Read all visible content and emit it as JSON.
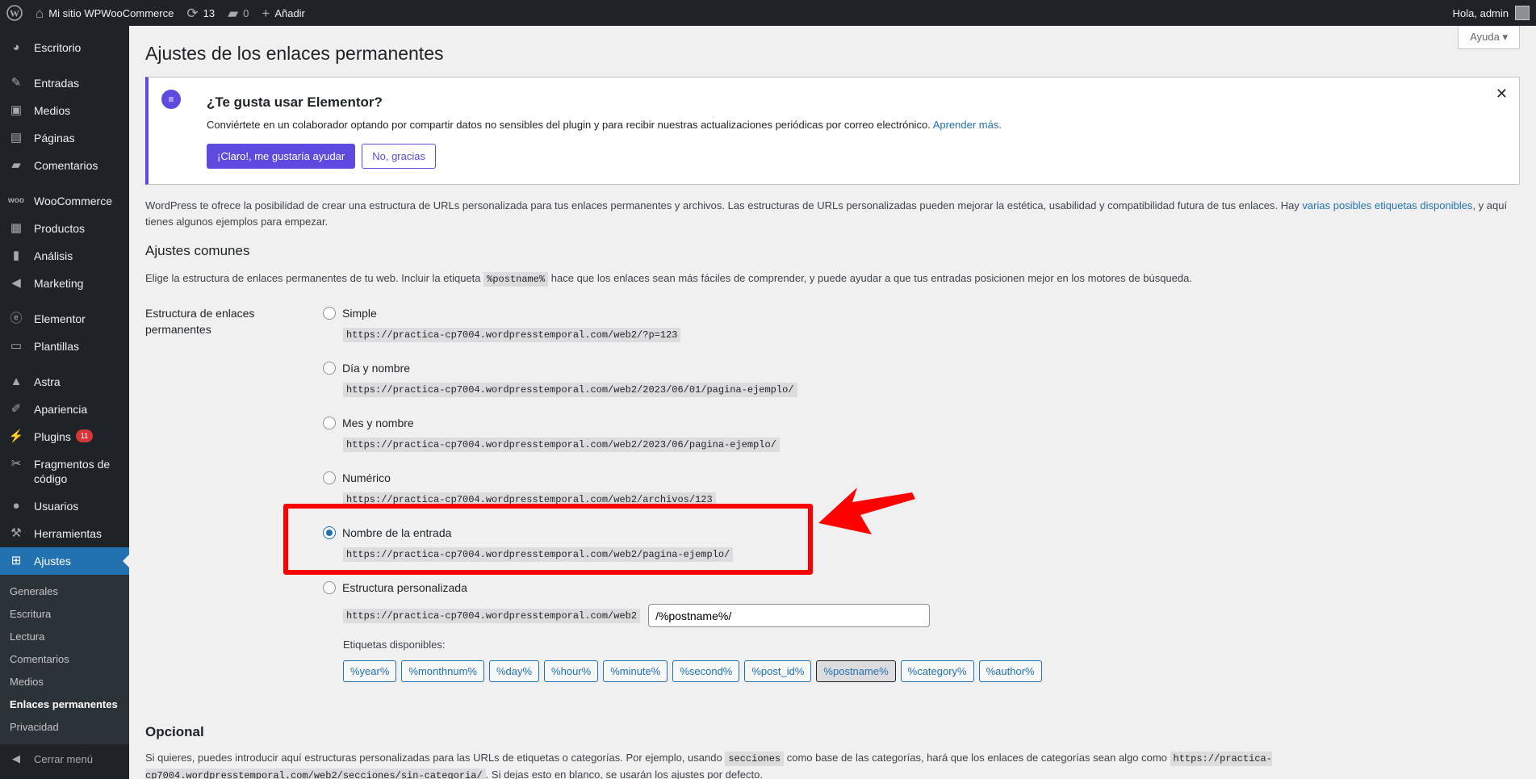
{
  "adminbar": {
    "site_name": "Mi sitio WPWooCommerce",
    "updates_count": "13",
    "comments_count": "0",
    "new_label": "Añadir",
    "greeting": "Hola, admin"
  },
  "sidebar": {
    "items": [
      {
        "label": "Escritorio",
        "icon": "dashboard-icon"
      },
      {
        "label": "Entradas",
        "icon": "pin-icon"
      },
      {
        "label": "Medios",
        "icon": "media-icon"
      },
      {
        "label": "Páginas",
        "icon": "pages-icon"
      },
      {
        "label": "Comentarios",
        "icon": "comments-icon"
      },
      {
        "label": "WooCommerce",
        "icon": "woo-icon"
      },
      {
        "label": "Productos",
        "icon": "archive-icon"
      },
      {
        "label": "Análisis",
        "icon": "chart-icon"
      },
      {
        "label": "Marketing",
        "icon": "megaphone-icon"
      },
      {
        "label": "Elementor",
        "icon": "elementor-icon"
      },
      {
        "label": "Plantillas",
        "icon": "folder-icon"
      },
      {
        "label": "Astra",
        "icon": "astra-icon"
      },
      {
        "label": "Apariencia",
        "icon": "brush-icon"
      },
      {
        "label": "Plugins",
        "icon": "plugin-icon",
        "badge": "11"
      },
      {
        "label": "Fragmentos de código",
        "icon": "scissors-icon"
      },
      {
        "label": "Usuarios",
        "icon": "users-icon"
      },
      {
        "label": "Herramientas",
        "icon": "wrench-icon"
      },
      {
        "label": "Ajustes",
        "icon": "settings-icon"
      }
    ],
    "submenu": [
      "Generales",
      "Escritura",
      "Lectura",
      "Comentarios",
      "Medios",
      "Enlaces permanentes",
      "Privacidad"
    ],
    "collapse_label": "Cerrar menú"
  },
  "page": {
    "help_label": "Ayuda",
    "title": "Ajustes de los enlaces permanentes",
    "notice": {
      "heading": "¿Te gusta usar Elementor?",
      "text": "Conviértete en un colaborador optando por compartir datos no sensibles del plugin y para recibir nuestras actualizaciones periódicas por correo electrónico.",
      "link": "Aprender más.",
      "primary_btn": "¡Claro!, me gustaría ayudar",
      "secondary_btn": "No, gracias"
    },
    "intro_a": "WordPress te ofrece la posibilidad de crear una estructura de URLs personalizada para tus enlaces permanentes y archivos. Las estructuras de URLs personalizadas pueden mejorar la estética, usabilidad y compatibilidad futura de tus enlaces. Hay ",
    "intro_link": "varias posibles etiquetas disponibles",
    "intro_b": ", y aquí tienes algunos ejemplos para empezar.",
    "common_heading": "Ajustes comunes",
    "common_desc_a": "Elige la estructura de enlaces permanentes de tu web. Incluir la etiqueta ",
    "common_desc_code": "%postname%",
    "common_desc_b": " hace que los enlaces sean más fáciles de comprender, y puede ayudar a que tus entradas posicionen mejor en los motores de búsqueda.",
    "structure_label": "Estructura de enlaces permanentes",
    "options": [
      {
        "label": "Simple",
        "sample": "https://practica-cp7004.wordpresstemporal.com/web2/?p=123",
        "checked": false
      },
      {
        "label": "Día y nombre",
        "sample": "https://practica-cp7004.wordpresstemporal.com/web2/2023/06/01/pagina-ejemplo/",
        "checked": false
      },
      {
        "label": "Mes y nombre",
        "sample": "https://practica-cp7004.wordpresstemporal.com/web2/2023/06/pagina-ejemplo/",
        "checked": false
      },
      {
        "label": "Numérico",
        "sample": "https://practica-cp7004.wordpresstemporal.com/web2/archivos/123",
        "checked": false
      },
      {
        "label": "Nombre de la entrada",
        "sample": "https://practica-cp7004.wordpresstemporal.com/web2/pagina-ejemplo/",
        "checked": true
      }
    ],
    "custom": {
      "label": "Estructura personalizada",
      "base": "https://practica-cp7004.wordpresstemporal.com/web2",
      "value": "/%postname%/"
    },
    "tags_label": "Etiquetas disponibles:",
    "tags": [
      "%year%",
      "%monthnum%",
      "%day%",
      "%hour%",
      "%minute%",
      "%second%",
      "%post_id%",
      "%postname%",
      "%category%",
      "%author%"
    ],
    "optional_heading": "Opcional",
    "optional_a": "Si quieres, puedes introducir aquí estructuras personalizadas para las URLs de etiquetas o categorías. Por ejemplo, usando ",
    "optional_code1": "secciones",
    "optional_b": " como base de las categorías, hará que los enlaces de categorías sean algo como ",
    "optional_code2": "https://practica-cp7004.wordpresstemporal.com/web2/secciones/sin-categoria/",
    "optional_c": ". Si dejas esto en blanco, se usarán los ajustes por defecto."
  },
  "colors": {
    "accent": "#2271b1",
    "elementor": "#5c4bde",
    "annotation": "#ff0000",
    "sidebar": "#1d2327"
  }
}
